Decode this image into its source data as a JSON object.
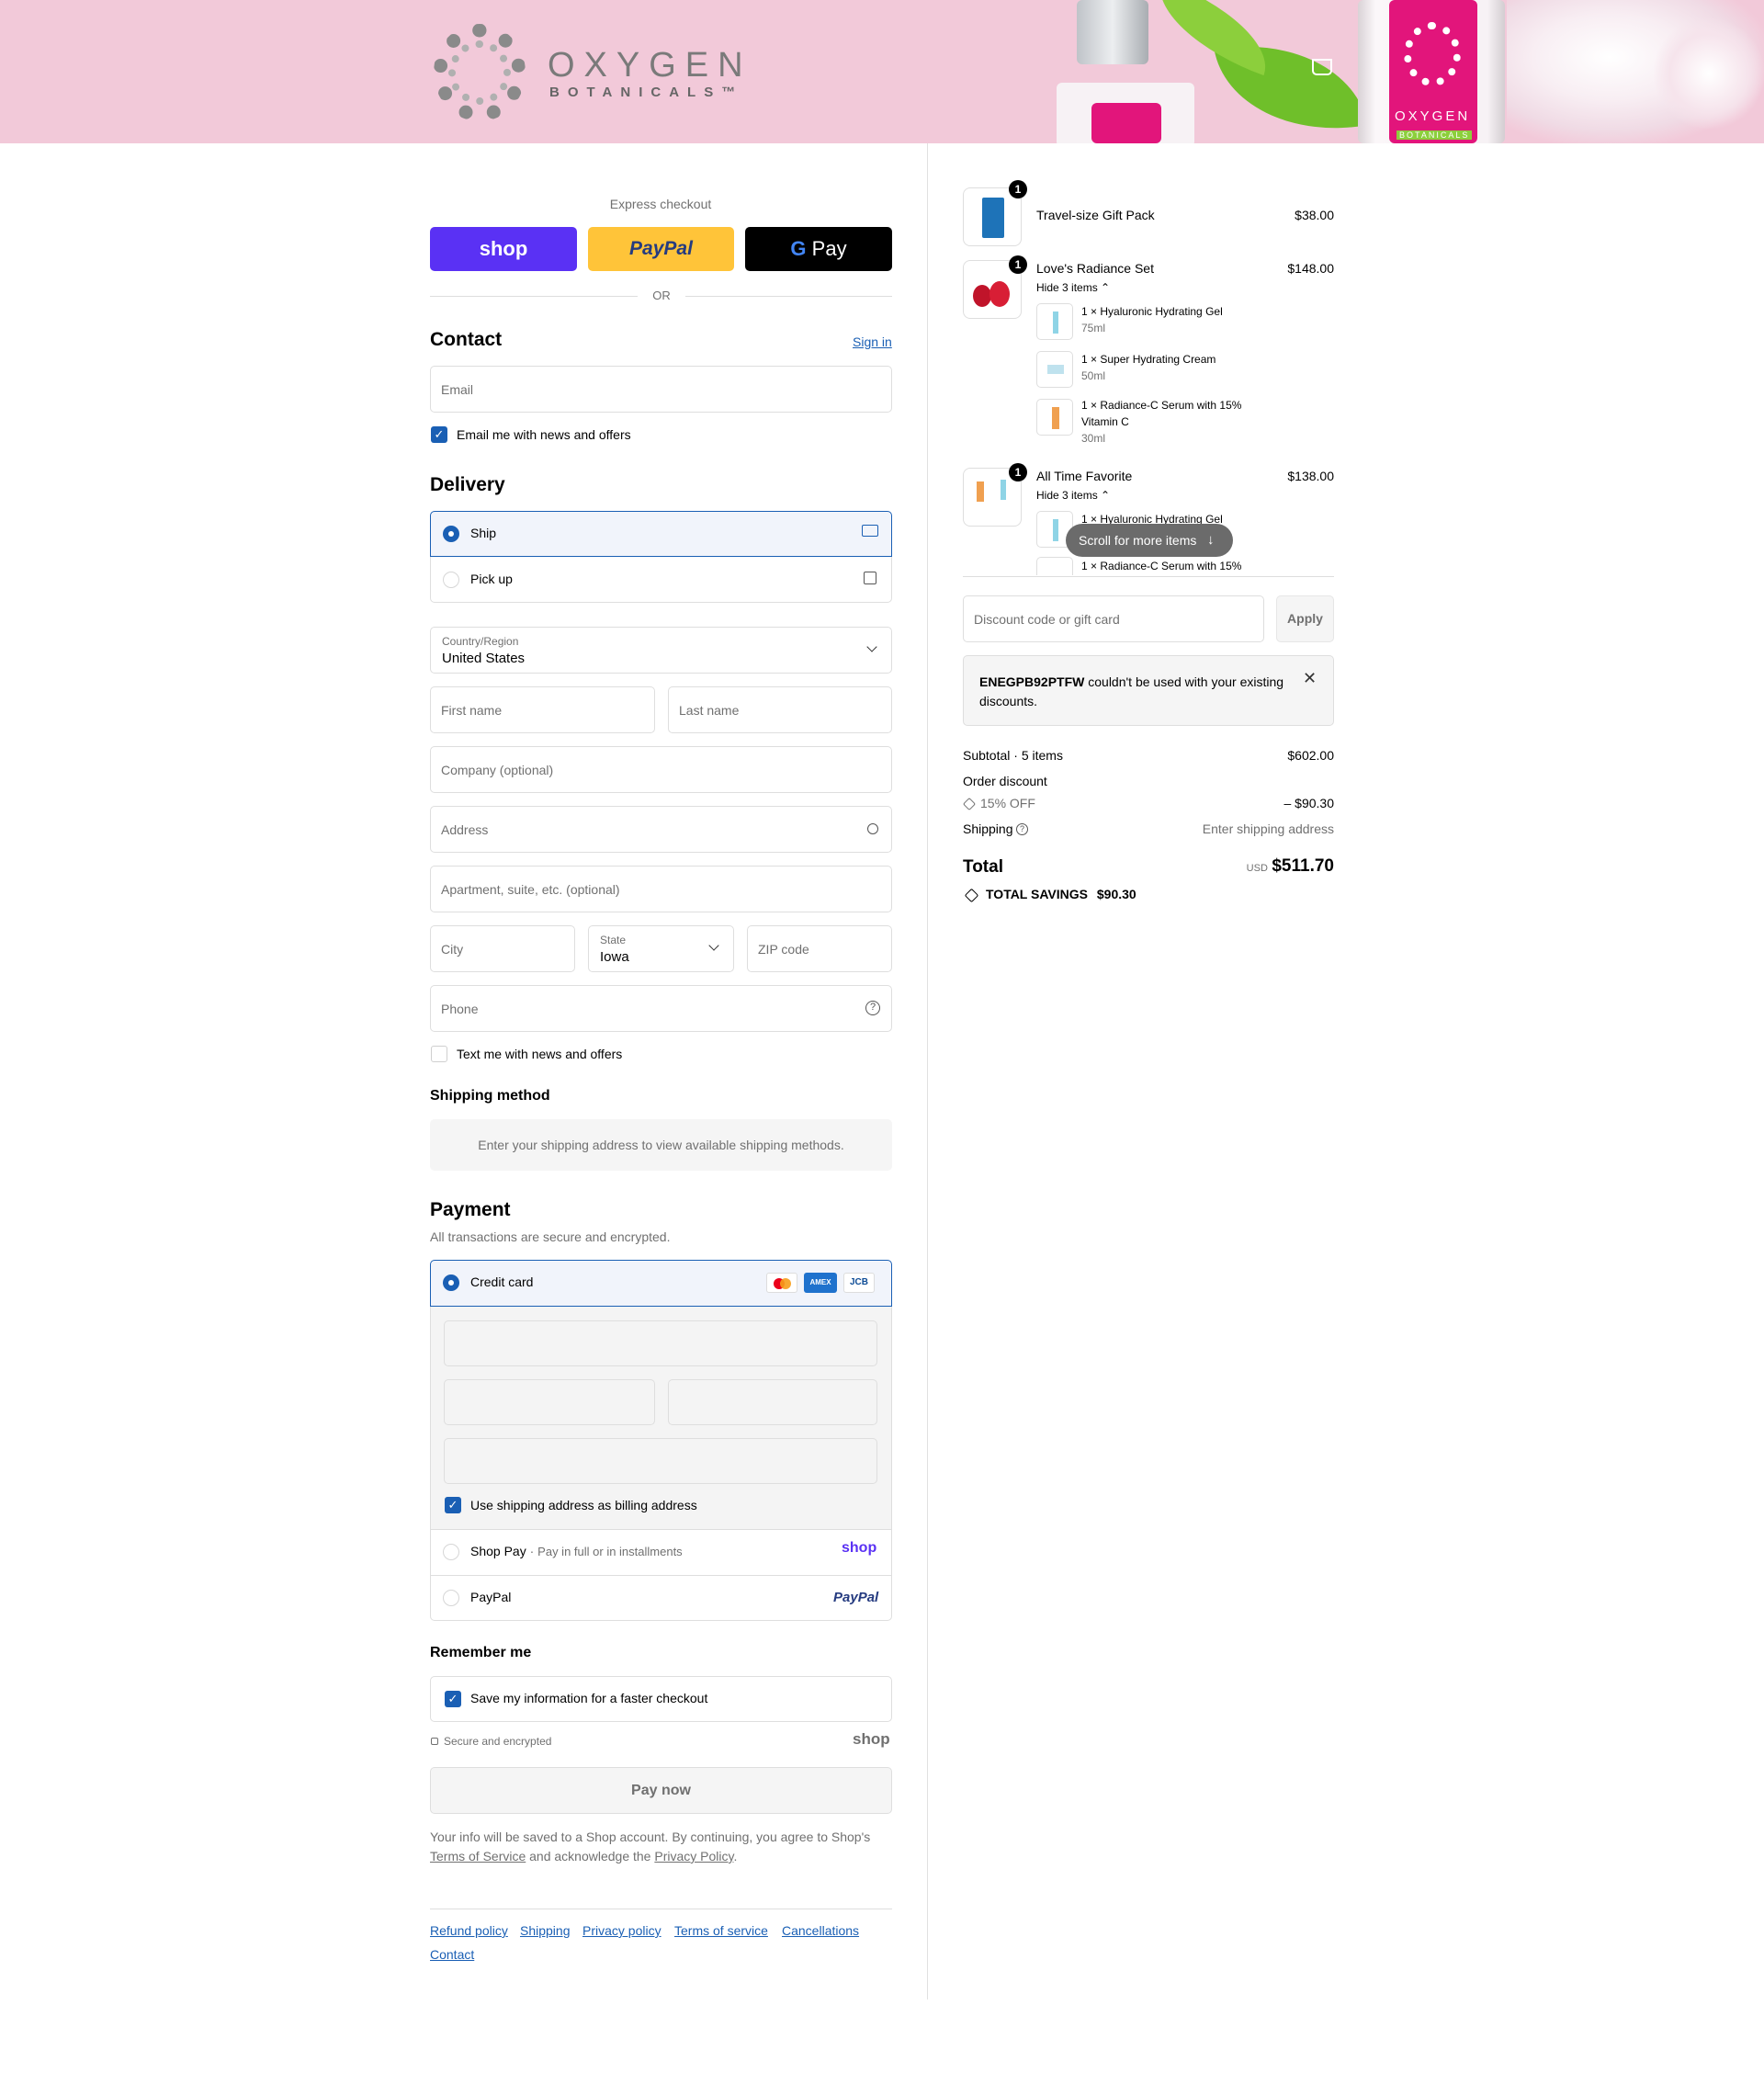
{
  "brand": {
    "name_line1": "OXYGEN",
    "name_line2": "BOTANICALS™",
    "bottle_text": "OXYGEN",
    "bottle_sub": "BOTANICALS"
  },
  "express": {
    "title": "Express checkout",
    "shop": "shop",
    "paypal": "PayPal",
    "gpay": "Pay",
    "or": "OR"
  },
  "contact": {
    "title": "Contact",
    "sign_in": "Sign in",
    "email_placeholder": "Email",
    "email_news": "Email me with news and offers"
  },
  "delivery": {
    "title": "Delivery",
    "ship": "Ship",
    "pickup": "Pick up",
    "country_label": "Country/Region",
    "country_value": "United States",
    "first_name": "First name",
    "last_name": "Last name",
    "company": "Company (optional)",
    "address": "Address",
    "apartment": "Apartment, suite, etc. (optional)",
    "city": "City",
    "state_label": "State",
    "state_value": "Iowa",
    "zip": "ZIP code",
    "phone": "Phone",
    "text_news": "Text me with news and offers"
  },
  "shipping_method": {
    "title": "Shipping method",
    "message": "Enter your shipping address to view available shipping methods."
  },
  "payment": {
    "title": "Payment",
    "subtitle": "All transactions are secure and encrypted.",
    "credit_card": "Credit card",
    "billing_same": "Use shipping address as billing address",
    "shop_pay": "Shop Pay",
    "shop_pay_sub": "Pay in full or in installments",
    "shop_pay_logo": "shop",
    "paypal": "PayPal",
    "paypal_logo": "PayPal",
    "card_logos": [
      "mastercard-icon",
      "amex-icon",
      "jcb-icon"
    ],
    "amex_text": "AMEX",
    "jcb_text": "JCB"
  },
  "remember": {
    "title": "Remember me",
    "save_info": "Save my information for a faster checkout",
    "secure": "Secure and encrypted",
    "shop_logo": "shop"
  },
  "pay_now": "Pay now",
  "legal": {
    "text1": "Your info will be saved to a Shop account. By continuing, you agree to Shop's",
    "tos": "Terms of Service",
    "text2": "and acknowledge the",
    "privacy": "Privacy Policy",
    "period": "."
  },
  "footer_links": [
    "Refund policy",
    "Shipping",
    "Privacy policy",
    "Terms of service",
    "Cancellations",
    "Contact"
  ],
  "cart": {
    "items": [
      {
        "name": "Travel-size Gift Pack",
        "price": "$38.00",
        "qty": "1"
      },
      {
        "name": "Love's Radiance Set",
        "price": "$148.00",
        "qty": "1",
        "toggle": "Hide 3 items",
        "sub": [
          {
            "name": "1 × Hyaluronic Hydrating Gel",
            "size": "75ml"
          },
          {
            "name": "1 × Super Hydrating Cream",
            "size": "50ml"
          },
          {
            "name": "1 × Radiance-C Serum with 15%",
            "name2": "Vitamin C",
            "size": "30ml"
          }
        ]
      },
      {
        "name": "All Time Favorite",
        "price": "$138.00",
        "qty": "1",
        "toggle": "Hide 3 items",
        "sub": [
          {
            "name": "1 × Hyaluronic Hydrating Gel"
          },
          {
            "name": "1 × Radiance-C Serum with 15%"
          }
        ]
      }
    ],
    "scroll_hint": "Scroll for more items",
    "discount_placeholder": "Discount code or gift card",
    "apply": "Apply",
    "error_code": "ENEGPB92PTFW",
    "error_text1": "couldn't be used with your existing",
    "error_text2": "discounts.",
    "subtotal_label": "Subtotal · 5 items",
    "subtotal": "$602.00",
    "order_discount": "Order discount",
    "discount_name": "15% OFF",
    "discount_amount": "– $90.30",
    "shipping_label": "Shipping",
    "shipping_value": "Enter shipping address",
    "total_label": "Total",
    "currency": "USD",
    "total": "$511.70",
    "savings_label": "TOTAL SAVINGS",
    "savings": "$90.30"
  },
  "colors": {
    "accent": "#1a5fb4",
    "shop_purple": "#5a31f4",
    "paypal_yellow": "#ffc439",
    "header_pink": "#f2c9d9"
  }
}
